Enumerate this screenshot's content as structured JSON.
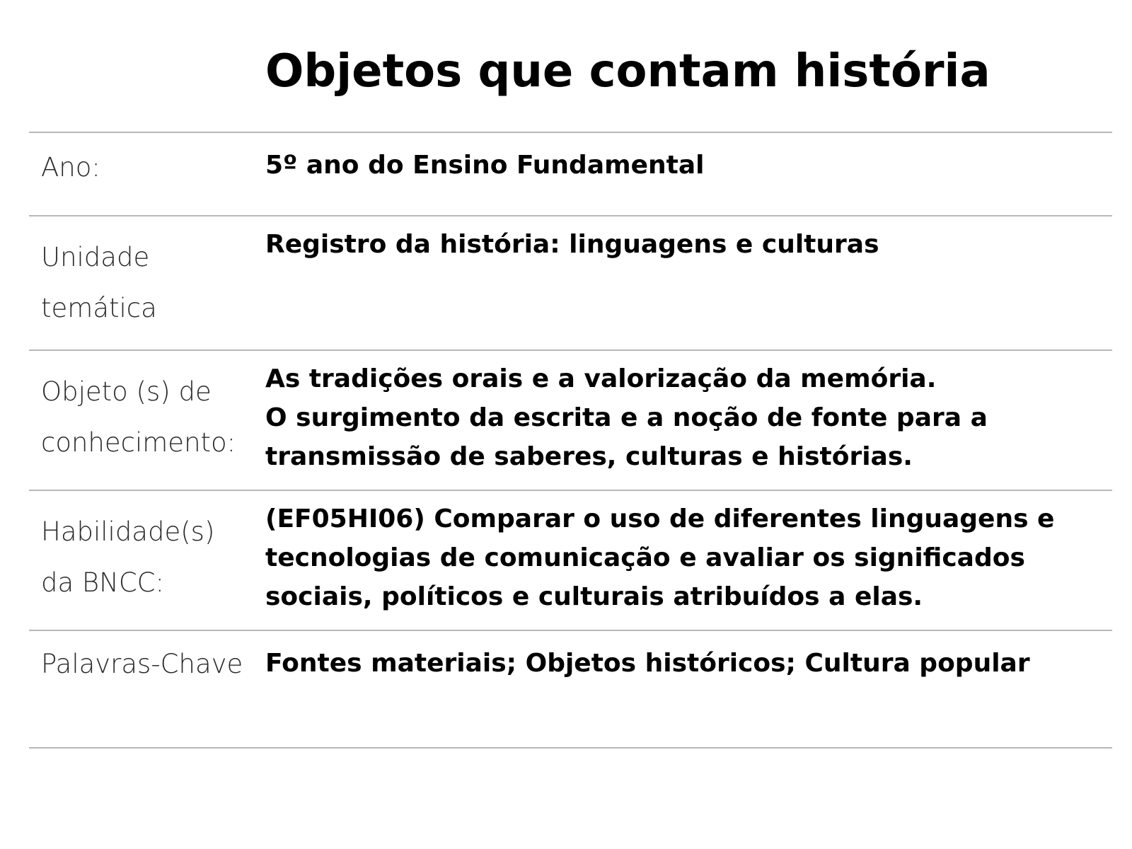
{
  "document": {
    "title": "Objetos que contam história",
    "rows": [
      {
        "label": "Ano:",
        "value": "5º ano do Ensino Fundamental"
      },
      {
        "label": "Unidade\ntemática",
        "value": "Registro da história: linguagens e culturas"
      },
      {
        "label": "Objeto (s) de\nconhecimento:",
        "value": "As tradições orais e a valorização da memória.\nO surgimento da escrita e a noção de fonte para a\ntransmissão de saberes, culturas e histórias."
      },
      {
        "label": "Habilidade(s)\nda BNCC:",
        "value": "(EF05HI06) Comparar o uso de diferentes linguagens e\ntecnologias  de comunicação e avaliar os significados\nsociais, políticos e culturais atribuídos a elas."
      },
      {
        "label": "Palavras-Chave",
        "value": "Fontes materiais; Objetos históricos; Cultura popular"
      }
    ]
  }
}
